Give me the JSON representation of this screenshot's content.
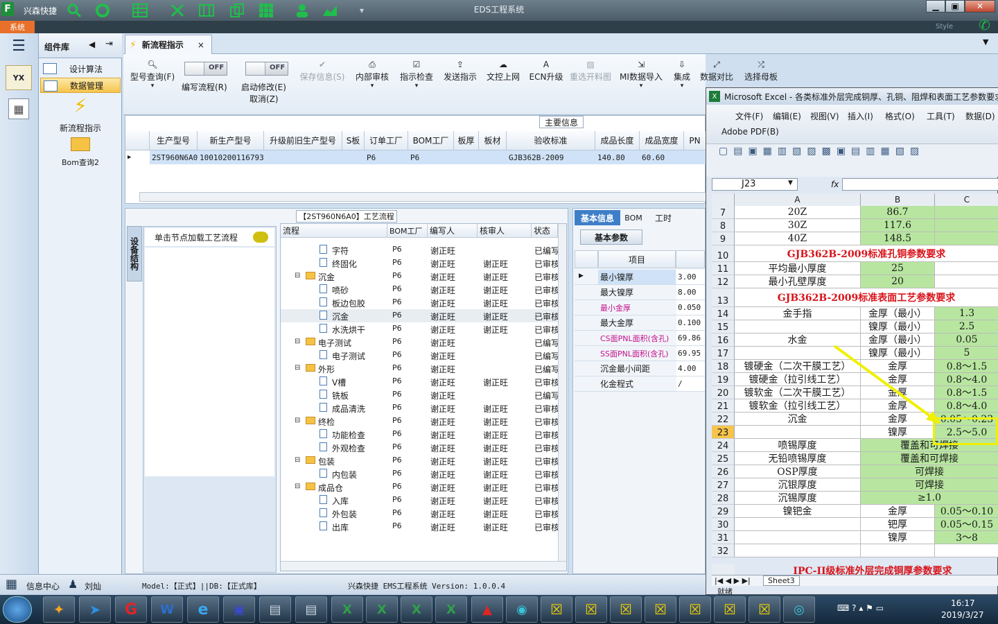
{
  "window": {
    "app_brand": "兴森快捷",
    "title": "EDS工程系统",
    "sys_menu": "系统",
    "style_label": "Style"
  },
  "left_panel": {
    "header": "组件库",
    "items": [
      {
        "label": "设计算法"
      },
      {
        "label": "数据管理"
      }
    ],
    "big_items": [
      {
        "label": "新流程指示"
      },
      {
        "label": "Bom查询2"
      }
    ]
  },
  "doc_tab": {
    "label": "新流程指示",
    "close": "×"
  },
  "toolbar": {
    "query": "型号查询(F)",
    "edit_flow": "编写流程(R)",
    "edit_flow_toggle": "OFF",
    "start_modify": "启动修改(E)",
    "start_modify_toggle": "OFF",
    "cancel": "取消(Z)",
    "buttons": [
      "保存信息(S)",
      "内部审核",
      "指示检查",
      "发送指示",
      "文控上网",
      "ECN升级",
      "重选开料图",
      "MI数据导入",
      "集成",
      "数据对比",
      "选择母板"
    ]
  },
  "main_info": {
    "title": "主要信息",
    "columns": [
      "生产型号",
      "新生产型号",
      "升级前旧生产型号",
      "S板",
      "订单工厂",
      "BOM工厂",
      "板厚",
      "板材",
      "验收标准",
      "成品长度",
      "成品宽度",
      "PN"
    ],
    "row": [
      "2ST960N6A0",
      "10010200116793",
      "",
      "",
      "P6",
      "P6",
      "",
      "",
      "GJB362B-2009",
      "140.80",
      "60.60",
      ""
    ]
  },
  "process": {
    "title": "【2ST960N6A0】工艺流程",
    "side_tab": "设备结构",
    "side_hint": "单击节点加载工艺流程",
    "columns": [
      "流程",
      "BOM工厂",
      "编写人",
      "核审人",
      "状态"
    ],
    "rows": [
      {
        "name": "字符",
        "folder": false,
        "bom": "P6",
        "writer": "谢正旺",
        "reviewer": "",
        "status": "已编写"
      },
      {
        "name": "终固化",
        "folder": false,
        "bom": "P6",
        "writer": "谢正旺",
        "reviewer": "谢正旺",
        "status": "已审核"
      },
      {
        "name": "沉金",
        "folder": true,
        "bom": "P6",
        "writer": "谢正旺",
        "reviewer": "谢正旺",
        "status": "已审核"
      },
      {
        "name": "喷砂",
        "folder": false,
        "bom": "P6",
        "writer": "谢正旺",
        "reviewer": "谢正旺",
        "status": "已审核"
      },
      {
        "name": "板边包胶",
        "folder": false,
        "bom": "P6",
        "writer": "谢正旺",
        "reviewer": "谢正旺",
        "status": "已审核"
      },
      {
        "name": "沉金",
        "folder": false,
        "bom": "P6",
        "writer": "谢正旺",
        "reviewer": "谢正旺",
        "status": "已审核"
      },
      {
        "name": "水洗烘干",
        "folder": false,
        "bom": "P6",
        "writer": "谢正旺",
        "reviewer": "谢正旺",
        "status": "已审核"
      },
      {
        "name": "电子测试",
        "folder": true,
        "bom": "P6",
        "writer": "谢正旺",
        "reviewer": "",
        "status": "已编写"
      },
      {
        "name": "电子测试",
        "folder": false,
        "bom": "P6",
        "writer": "谢正旺",
        "reviewer": "",
        "status": "已编写"
      },
      {
        "name": "外形",
        "folder": true,
        "bom": "P6",
        "writer": "谢正旺",
        "reviewer": "",
        "status": "已编写"
      },
      {
        "name": "V槽",
        "folder": false,
        "bom": "P6",
        "writer": "谢正旺",
        "reviewer": "谢正旺",
        "status": "已审核"
      },
      {
        "name": "铣板",
        "folder": false,
        "bom": "P6",
        "writer": "谢正旺",
        "reviewer": "",
        "status": "已编写"
      },
      {
        "name": "成品清洗",
        "folder": false,
        "bom": "P6",
        "writer": "谢正旺",
        "reviewer": "谢正旺",
        "status": "已审核"
      },
      {
        "name": "终检",
        "folder": true,
        "bom": "P6",
        "writer": "谢正旺",
        "reviewer": "谢正旺",
        "status": "已审核"
      },
      {
        "name": "功能检查",
        "folder": false,
        "bom": "P6",
        "writer": "谢正旺",
        "reviewer": "谢正旺",
        "status": "已审核"
      },
      {
        "name": "外观检查",
        "folder": false,
        "bom": "P6",
        "writer": "谢正旺",
        "reviewer": "谢正旺",
        "status": "已审核"
      },
      {
        "name": "包装",
        "folder": true,
        "bom": "P6",
        "writer": "谢正旺",
        "reviewer": "谢正旺",
        "status": "已审核"
      },
      {
        "name": "内包装",
        "folder": false,
        "bom": "P6",
        "writer": "谢正旺",
        "reviewer": "谢正旺",
        "status": "已审核"
      },
      {
        "name": "成品仓",
        "folder": true,
        "bom": "P6",
        "writer": "谢正旺",
        "reviewer": "谢正旺",
        "status": "已审核"
      },
      {
        "name": "入库",
        "folder": false,
        "bom": "P6",
        "writer": "谢正旺",
        "reviewer": "谢正旺",
        "status": "已审核"
      },
      {
        "name": "外包装",
        "folder": false,
        "bom": "P6",
        "writer": "谢正旺",
        "reviewer": "谢正旺",
        "status": "已审核"
      },
      {
        "name": "出库",
        "folder": false,
        "bom": "P6",
        "writer": "谢正旺",
        "reviewer": "谢正旺",
        "status": "已审核"
      }
    ]
  },
  "basic": {
    "tabs": [
      "基本信息",
      "BOM",
      "工时"
    ],
    "subtab": "基本参数",
    "col_header": "项目",
    "rows": [
      {
        "k": "最小镍厚",
        "v": "3.00",
        "pink": false
      },
      {
        "k": "最大镍厚",
        "v": "8.00",
        "pink": false
      },
      {
        "k": "最小金厚",
        "v": "0.050",
        "pink": true
      },
      {
        "k": "最大金厚",
        "v": "0.100",
        "pink": false
      },
      {
        "k": "CS面PNL面积(含孔)",
        "v": "69.86",
        "pink": true
      },
      {
        "k": "SS面PNL面积(含孔)",
        "v": "69.95",
        "pink": true
      },
      {
        "k": "沉金最小间距",
        "v": "4.00",
        "pink": false
      },
      {
        "k": "化金程式",
        "v": "/",
        "pink": false
      }
    ]
  },
  "status": {
    "info_center": "信息中心",
    "user": "刘灿",
    "model": "Model:【正式】||DB:【正式库】",
    "version": "兴森快捷 EMS工程系统 Version: 1.0.0.4"
  },
  "excel": {
    "title": "Microsoft Excel - 各类标准外层完成铜厚、孔铜、阻焊和表面工艺参数要求",
    "menu": [
      "文件(F)",
      "编辑(E)",
      "视图(V)",
      "插入(I)",
      "格式(O)",
      "工具(T)",
      "数据(D)"
    ],
    "menu2": "Adobe PDF(B)",
    "namebox": "J23",
    "fx": "fx",
    "col_headers": [
      "A",
      "B",
      "C"
    ],
    "rows": [
      {
        "n": "7",
        "a": "20Z",
        "b": "86.7",
        "c": ""
      },
      {
        "n": "8",
        "a": "30Z",
        "b": "117.6",
        "c": ""
      },
      {
        "n": "9",
        "a": "40Z",
        "b": "148.5",
        "c": ""
      },
      {
        "n": "10",
        "title": "GJB362B-2009标准孔铜参数要求"
      },
      {
        "n": "11",
        "a": "平均最小厚度",
        "b": "25",
        "c": ""
      },
      {
        "n": "12",
        "a": "最小孔壁厚度",
        "b": "20",
        "c": ""
      },
      {
        "n": "13",
        "title": "GJB362B-2009标准表面工艺参数要求"
      },
      {
        "n": "14",
        "a": "金手指",
        "b": "金厚（最小）",
        "c": "1.3"
      },
      {
        "n": "15",
        "a": "",
        "b": "镍厚（最小）",
        "c": "2.5"
      },
      {
        "n": "16",
        "a": "水金",
        "b": "金厚（最小）",
        "c": "0.05"
      },
      {
        "n": "17",
        "a": "",
        "b": "镍厚（最小）",
        "c": "5"
      },
      {
        "n": "18",
        "a": "镀硬金（二次干膜工艺）",
        "b": "金厚",
        "c": "0.8～1.5"
      },
      {
        "n": "19",
        "a": "镀硬金（拉引线工艺）",
        "b": "金厚",
        "c": "0.8～4.0"
      },
      {
        "n": "20",
        "a": "镀软金（二次干膜工艺）",
        "b": "金厚",
        "c": "0.8～1.5"
      },
      {
        "n": "21",
        "a": "镀软金（拉引线工艺）",
        "b": "金厚",
        "c": "0.8～4.0"
      },
      {
        "n": "22",
        "a": "沉金",
        "b": "金厚",
        "c": "0.05～0.23"
      },
      {
        "n": "23",
        "a": "",
        "b": "镍厚",
        "c": "2.5～5.0"
      },
      {
        "n": "24",
        "a": "喷锡厚度",
        "bc": "覆盖和可焊接"
      },
      {
        "n": "25",
        "a": "无铅喷锡厚度",
        "bc": "覆盖和可焊接"
      },
      {
        "n": "26",
        "a": "OSP厚度",
        "bc": "可焊接"
      },
      {
        "n": "27",
        "a": "沉银厚度",
        "bc": "可焊接"
      },
      {
        "n": "28",
        "a": "沉锡厚度",
        "bc": "≥1.0"
      },
      {
        "n": "29",
        "a": "镍钯金",
        "b": "金厚",
        "c": "0.05～0.10"
      },
      {
        "n": "30",
        "a": "",
        "b": "钯厚",
        "c": "0.05～0.15"
      },
      {
        "n": "31",
        "a": "",
        "b": "镍厚",
        "c": "3～8"
      },
      {
        "n": "32",
        "a": "",
        "b": "",
        "c": ""
      }
    ],
    "next_title": "IPC-II级标准外层完成铜厚参数要求",
    "sheet_tab": "Sheet3",
    "status": "就绪"
  },
  "taskbar": {
    "time": "16:17",
    "date": "2019/3/27"
  },
  "colors": {
    "title_bar": "#4b5b67",
    "accent": "#e8702a",
    "selection": "#cfe2f7",
    "excel_green": "#b8e6a0",
    "excel_red": "#d9141b",
    "callout": "#f0f000"
  }
}
